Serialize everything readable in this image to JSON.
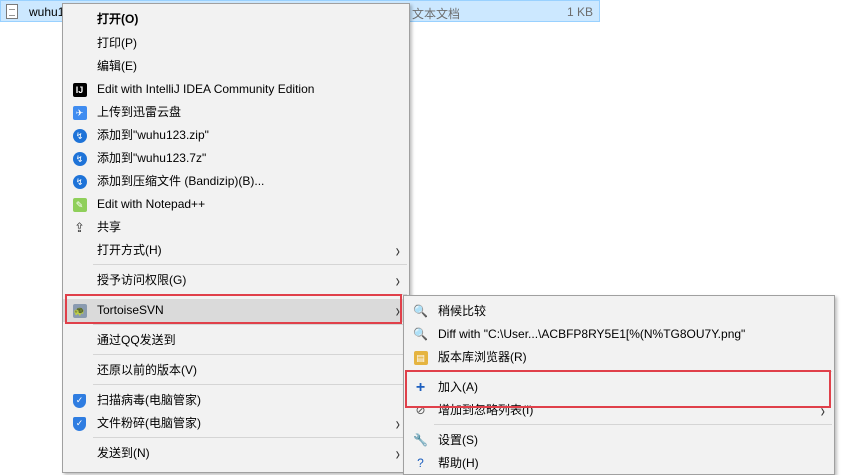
{
  "explorer_row": {
    "filename": "wuhu1",
    "type": "文本文档",
    "size": "1 KB"
  },
  "context_menu": {
    "items": [
      {
        "label": "打开(O)",
        "icon": "none",
        "bold": true
      },
      {
        "label": "打印(P)",
        "icon": "none"
      },
      {
        "label": "编辑(E)",
        "icon": "none"
      },
      {
        "label": "Edit with IntelliJ IDEA Community Edition",
        "icon": "intellij-icon"
      },
      {
        "label": "上传到迅雷云盘",
        "icon": "thunder-icon"
      },
      {
        "label": "添加到\"wuhu123.zip\"",
        "icon": "bandizip-icon"
      },
      {
        "label": "添加到\"wuhu123.7z\"",
        "icon": "bandizip-icon"
      },
      {
        "label": "添加到压缩文件 (Bandizip)(B)...",
        "icon": "bandizip-icon"
      },
      {
        "label": "Edit with Notepad++",
        "icon": "notepadpp-icon"
      },
      {
        "label": "共享",
        "icon": "share-icon"
      },
      {
        "label": "打开方式(H)",
        "icon": "none",
        "submenu": true
      },
      {
        "label": "授予访问权限(G)",
        "icon": "none",
        "submenu": true
      },
      {
        "label": "TortoiseSVN",
        "icon": "tortoisesvn-icon",
        "submenu": true
      },
      {
        "label": "通过QQ发送到",
        "icon": "none"
      },
      {
        "label": "还原以前的版本(V)",
        "icon": "none"
      },
      {
        "label": "扫描病毒(电脑管家)",
        "icon": "tencent-shield-icon"
      },
      {
        "label": "文件粉碎(电脑管家)",
        "icon": "tencent-shield-icon",
        "submenu": true
      },
      {
        "label": "发送到(N)",
        "icon": "none",
        "submenu": true
      }
    ]
  },
  "svn_submenu": {
    "items": [
      {
        "label": "稍候比较",
        "icon": "magnifier-icon"
      },
      {
        "label": "Diff with \"C:\\User...\\ACBFP8RY5E1[%(N%TG8OU7Y.png\"",
        "icon": "magnifier-icon"
      },
      {
        "label": "版本库浏览器(R)",
        "icon": "repo-browser-icon"
      },
      {
        "label": "加入(A)",
        "icon": "plus-icon"
      },
      {
        "label": "增加到忽略列表(I)",
        "icon": "ignore-icon",
        "submenu": true
      },
      {
        "label": "设置(S)",
        "icon": "settings-icon"
      },
      {
        "label": "帮助(H)",
        "icon": "help-icon"
      }
    ]
  },
  "colors": {
    "highlight_border": "#e0404a",
    "menu_bg": "#f2f2f2",
    "selection_bg": "#cce8ff"
  }
}
